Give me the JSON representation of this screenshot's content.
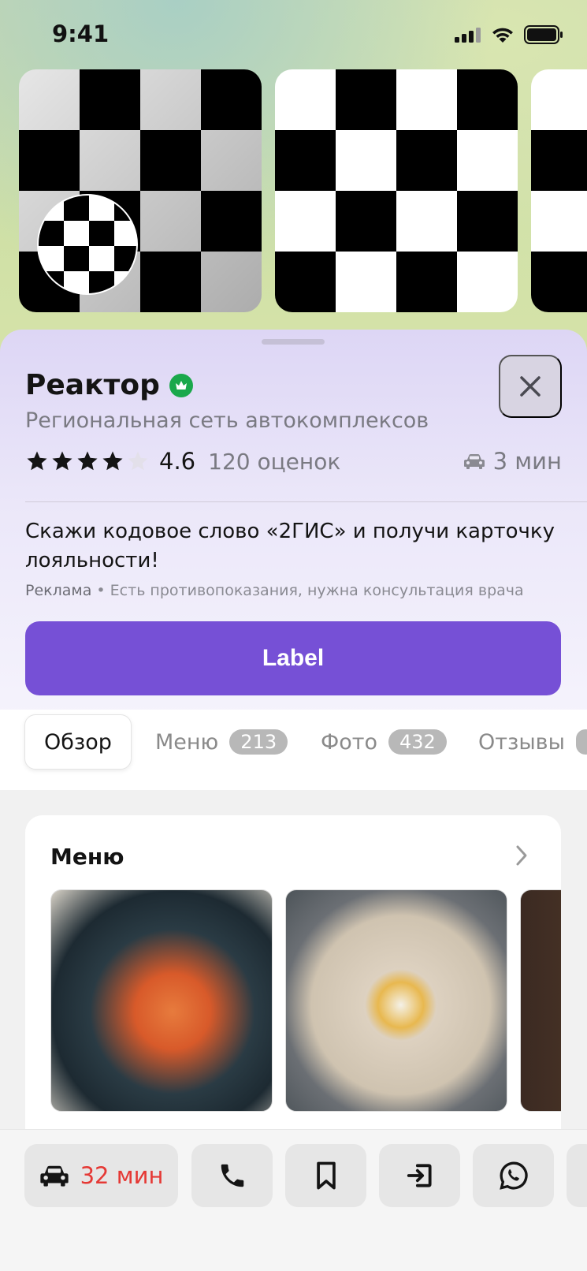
{
  "status_bar": {
    "time": "9:41"
  },
  "place": {
    "name": "Реактор",
    "category": "Региональная сеть автокомплексов",
    "rating": "4.6",
    "rating_stars": 4,
    "reviews": "120 оценок",
    "eta": "3 мин"
  },
  "promo": {
    "text": "Скажи кодовое слово «2ГИС» и получи карточку лояльности!",
    "ad_label": "Реклама",
    "ad_note": " • Есть противопоказания, нужна консультация врача",
    "button_label": "Label"
  },
  "tabs": [
    {
      "label": "Обзор",
      "count": ""
    },
    {
      "label": "Меню",
      "count": "213"
    },
    {
      "label": "Фото",
      "count": "432"
    },
    {
      "label": "Отзывы",
      "count": ""
    }
  ],
  "menu_card": {
    "title": "Меню"
  },
  "bottom_bar": {
    "drive_time": "32 мин"
  },
  "colors": {
    "accent": "#7650d6",
    "verified": "#1aa84b",
    "drive_time": "#e53935"
  }
}
